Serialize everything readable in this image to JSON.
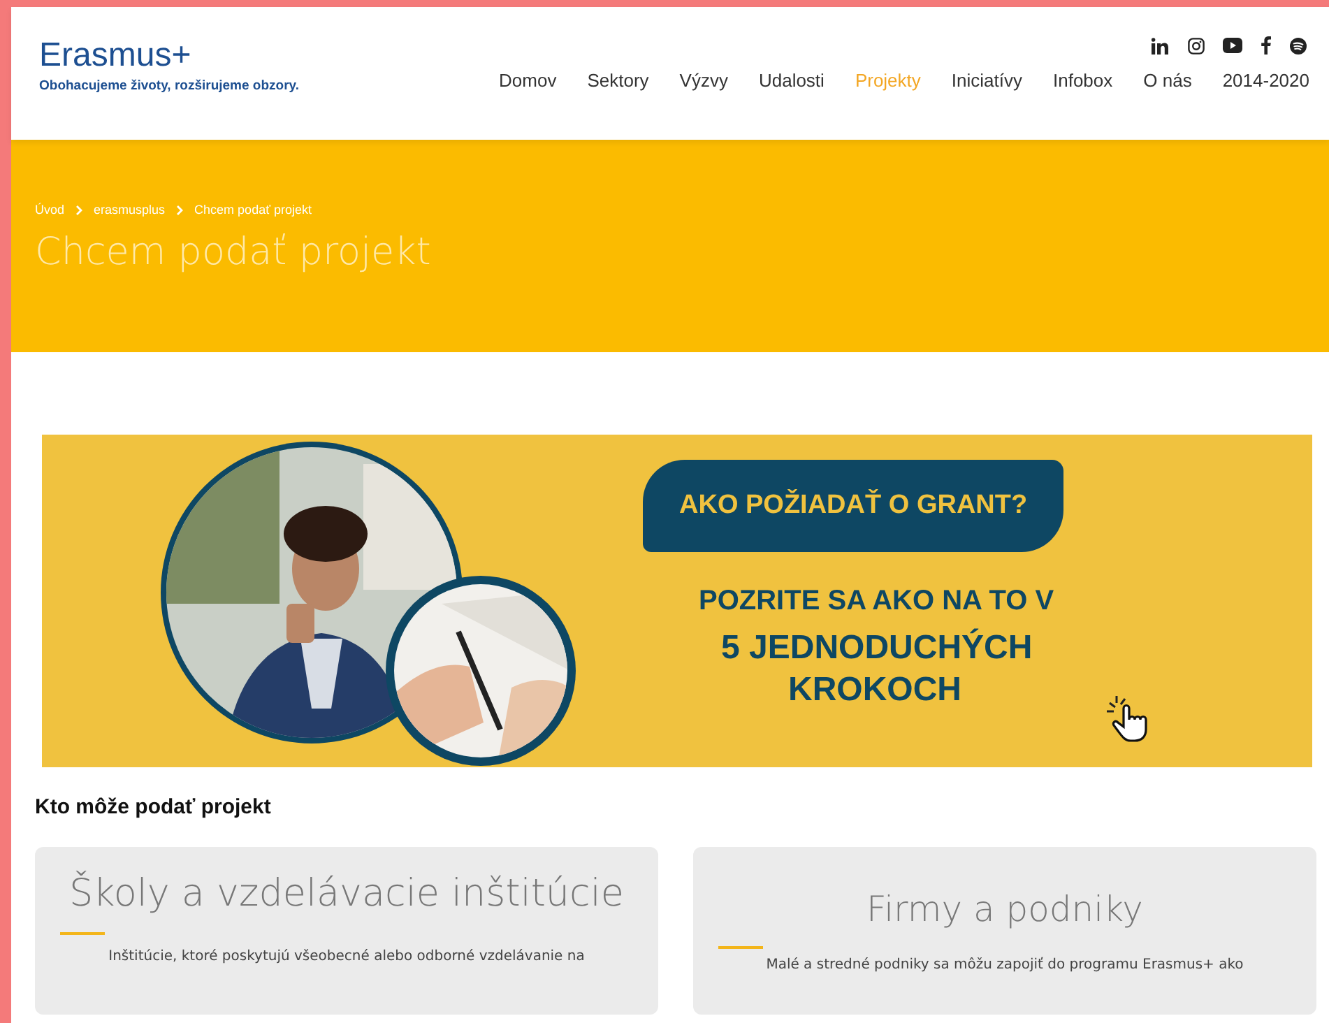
{
  "header": {
    "logo": "Erasmus+",
    "tagline": "Obohacujeme životy, rozširujeme obzory.",
    "nav": [
      {
        "label": "Domov",
        "selected": false
      },
      {
        "label": "Sektory",
        "selected": false
      },
      {
        "label": "Výzvy",
        "selected": false
      },
      {
        "label": "Udalosti",
        "selected": false
      },
      {
        "label": "Projekty",
        "selected": true
      },
      {
        "label": "Iniciatívy",
        "selected": false
      },
      {
        "label": "Infobox",
        "selected": false
      },
      {
        "label": "O nás",
        "selected": false
      },
      {
        "label": "2014-2020",
        "selected": false
      }
    ]
  },
  "hero": {
    "breadcrumbs": [
      "Úvod",
      "erasmusplus",
      "Chcem podať projekt"
    ],
    "title": "Chcem podať projekt"
  },
  "banner": {
    "kind": "picture",
    "headline": "AKO POŽIADAŤ O GRANT?",
    "line_1": "POZRITE SA AKO NA TO V",
    "line_2": "5 JEDNODUCHÝCH",
    "line_3": "KROKOCH"
  },
  "section_title": "Kto môže podať projekt",
  "cards": [
    {
      "title": "Školy a vzdelávacie inštitúcie",
      "text": "Inštitúcie, ktoré poskytujú všeobecné alebo odborné vzdelávanie na"
    },
    {
      "title": "Firmy a podniky",
      "text": "Malé a stredné podniky sa môžu zapojiť do programu Erasmus+ ako"
    }
  ]
}
